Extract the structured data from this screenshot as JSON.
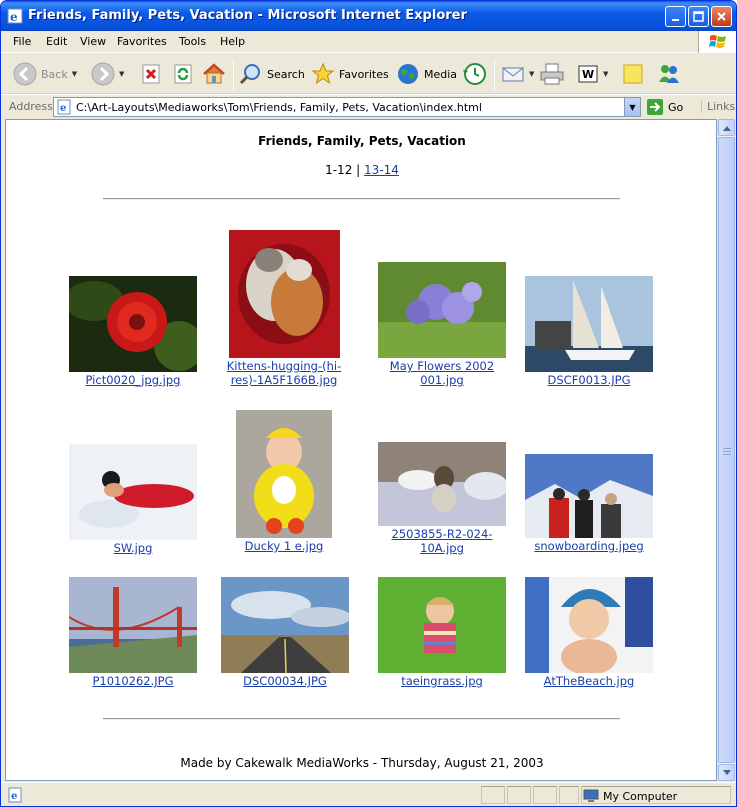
{
  "window": {
    "title": "Friends, Family, Pets, Vacation - Microsoft Internet Explorer"
  },
  "menu": {
    "items": [
      {
        "label": "File"
      },
      {
        "label": "Edit"
      },
      {
        "label": "View"
      },
      {
        "label": "Favorites"
      },
      {
        "label": "Tools"
      },
      {
        "label": "Help"
      }
    ]
  },
  "toolbar": {
    "back_label": "Back",
    "search_label": "Search",
    "favorites_label": "Favorites",
    "media_label": "Media"
  },
  "address": {
    "label": "Address",
    "url": "C:\\Art-Layouts\\Mediaworks\\Tom\\Friends, Family, Pets, Vacation\\index.html",
    "go_label": "Go",
    "links_label": "Links"
  },
  "page": {
    "title": "Friends, Family, Pets, Vacation",
    "pager_current": "1-12",
    "pager_sep": "|",
    "pager_next": "13-14",
    "footer": "Made by Cakewalk MediaWorks - Thursday, August 21, 2003",
    "thumbnails": [
      {
        "caption": "Pict0020_jpg.jpg"
      },
      {
        "caption": "Kittens-hugging-(hi-res)-1A5F166B.jpg"
      },
      {
        "caption": "May Flowers 2002 001.jpg"
      },
      {
        "caption": "DSCF0013.JPG"
      },
      {
        "caption": "SW.jpg"
      },
      {
        "caption": "Ducky 1 e.jpg"
      },
      {
        "caption": "2503855-R2-024-10A.jpg"
      },
      {
        "caption": "snowboarding.jpeg"
      },
      {
        "caption": "P1010262.JPG"
      },
      {
        "caption": "DSC00034.JPG"
      },
      {
        "caption": "taeingrass.jpg"
      },
      {
        "caption": "AtTheBeach.jpg"
      }
    ]
  },
  "status": {
    "zone": "My Computer"
  }
}
